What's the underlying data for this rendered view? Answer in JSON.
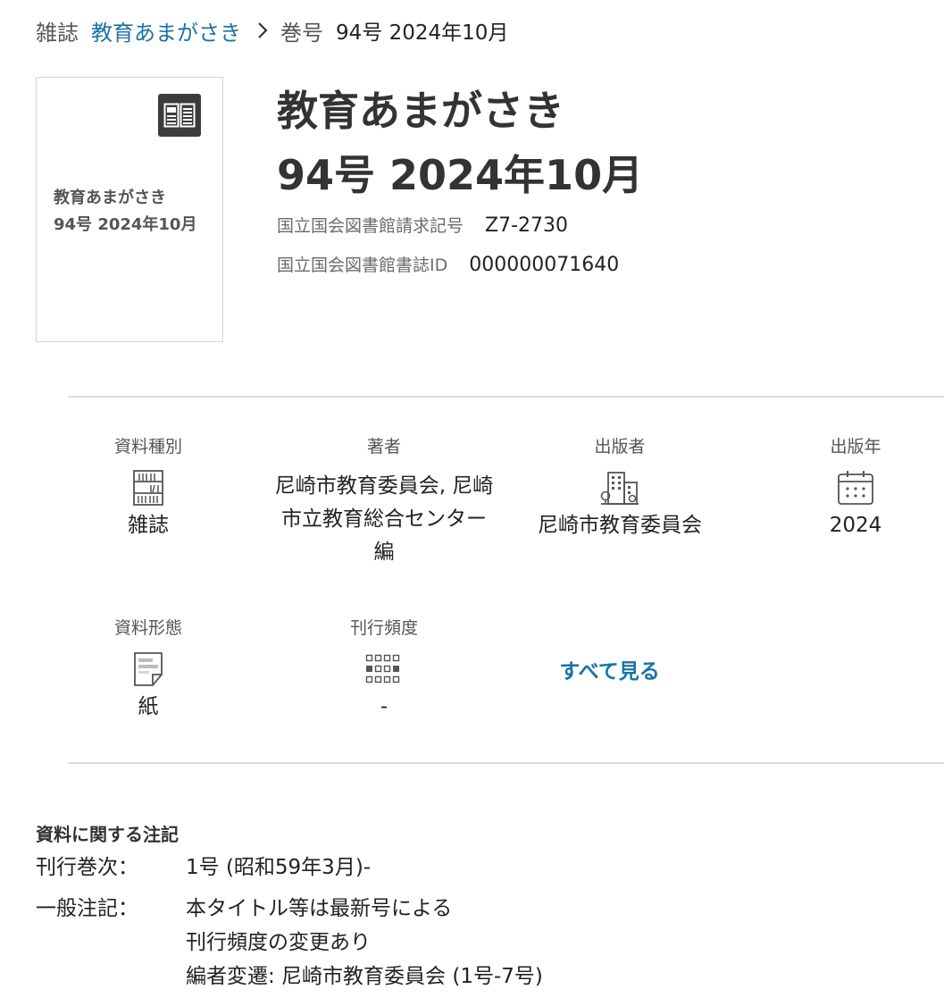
{
  "breadcrumb": {
    "magazine_label": "雑誌",
    "magazine_link": "教育あまがさき",
    "issue_label": "巻号",
    "issue_value": "94号 2024年10月"
  },
  "cover": {
    "icon": "book-icon",
    "line1": "教育あまがさき",
    "line2": "94号 2024年10月"
  },
  "title": {
    "line1": "教育あまがさき",
    "line2": "94号 2024年10月"
  },
  "meta": {
    "call_number_label": "国立国会図書館請求記号",
    "call_number_value": "Z7-2730",
    "bib_id_label": "国立国会図書館書誌ID",
    "bib_id_value": "000000071640"
  },
  "info": {
    "material_type": {
      "label": "資料種別",
      "icon": "bookshelf-icon",
      "value": "雑誌"
    },
    "author": {
      "label": "著者",
      "value": "尼崎市教育委員会, 尼崎市立教育総合センター 編"
    },
    "publisher": {
      "label": "出版者",
      "icon": "building-icon",
      "value": "尼崎市教育委員会"
    },
    "pub_year": {
      "label": "出版年",
      "icon": "calendar-icon",
      "value": "2024"
    },
    "format": {
      "label": "資料形態",
      "icon": "paper-icon",
      "value": "紙"
    },
    "frequency": {
      "label": "刊行頻度",
      "icon": "frequency-grid-icon",
      "value": "-"
    },
    "see_all": "すべて見る"
  },
  "notes": {
    "heading": "資料に関する注記",
    "volumes_label": "刊行巻次：",
    "volumes_values": [
      "1号 (昭和59年3月)-"
    ],
    "general_label": "一般注記：",
    "general_values": [
      "本タイトル等は最新号による",
      "刊行頻度の変更あり",
      "編者変遷: 尼崎市教育委員会 (1号-7号)"
    ]
  },
  "colors": {
    "link": "#1a73a8",
    "divider": "#dddddd",
    "text": "#222222",
    "muted": "#6b6b6b"
  }
}
